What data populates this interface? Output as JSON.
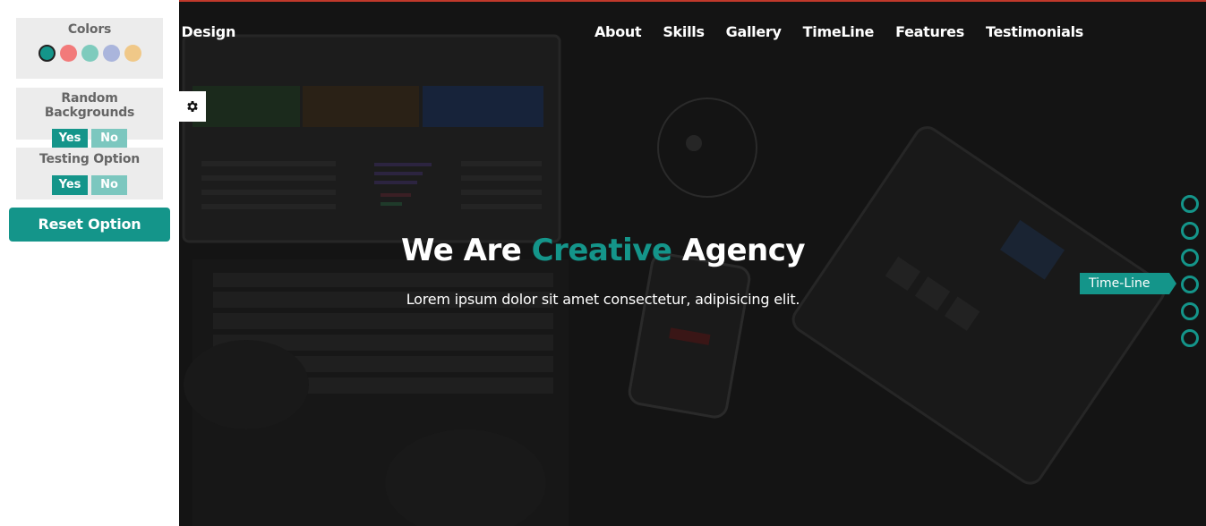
{
  "brand": "Spicie Design",
  "nav": {
    "items": [
      "About",
      "Skills",
      "Gallery",
      "TimeLine",
      "Features",
      "Testimonials"
    ]
  },
  "hero": {
    "title_pre": "We Are",
    "title_accent": "Creative",
    "title_post": "Agency",
    "subtitle": "Lorem ipsum dolor sit amet consectetur, adipisicing elit."
  },
  "bullets": {
    "count": 6,
    "active_index": 3,
    "active_label": "Time-Line"
  },
  "settings": {
    "gear_icon": "gear-icon",
    "colors_title": "Colors",
    "colors": [
      "#14958a",
      "#f27a7a",
      "#7ecbbd",
      "#aab5dc",
      "#f0c888"
    ],
    "active_color": "#14958a",
    "random_bg_title": "Random Backgrounds",
    "testing_title": "Testing Option",
    "yes_label": "Yes",
    "no_label": "No",
    "reset_label": "Reset Option"
  },
  "theme": {
    "accent": "#14958a",
    "topline": "#c0392b"
  }
}
